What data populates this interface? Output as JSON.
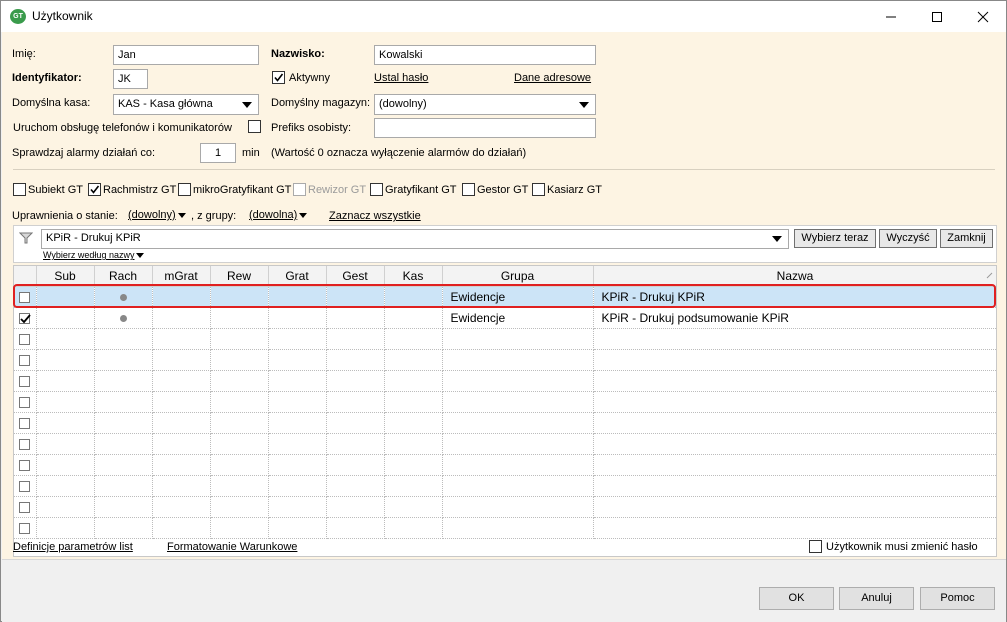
{
  "window": {
    "title": "Użytkownik",
    "icon_text": "GT"
  },
  "form": {
    "first_name_label": "Imię:",
    "first_name_value": "Jan",
    "last_name_label": "Nazwisko:",
    "last_name_value": "Kowalski",
    "identifier_label": "Identyfikator:",
    "identifier_value": "JK",
    "active_label": "Aktywny",
    "set_password_link": "Ustal hasło",
    "address_link": "Dane adresowe",
    "default_cash_label": "Domyślna kasa:",
    "default_cash_value": "KAS - Kasa główna",
    "default_warehouse_label": "Domyślny magazyn:",
    "default_warehouse_value": "(dowolny)",
    "phone_service_label": "Uruchom obsługę telefonów i komunikatorów",
    "personal_prefix_label": "Prefiks osobisty:",
    "personal_prefix_value": "",
    "alarm_label": "Sprawdzaj alarmy działań co:",
    "alarm_value": "1",
    "alarm_unit": "min",
    "alarm_note": "(Wartość 0 oznacza wyłączenie alarmów do działań)"
  },
  "modules": [
    {
      "label": "Subiekt GT",
      "checked": false,
      "disabled": false
    },
    {
      "label": "Rachmistrz GT",
      "checked": true,
      "disabled": false
    },
    {
      "label": "mikroGratyfikant GT",
      "checked": false,
      "disabled": false
    },
    {
      "label": "Rewizor GT",
      "checked": false,
      "disabled": true
    },
    {
      "label": "Gratyfikant GT",
      "checked": false,
      "disabled": false
    },
    {
      "label": "Gestor GT",
      "checked": false,
      "disabled": false
    },
    {
      "label": "Kasiarz GT",
      "checked": false,
      "disabled": false
    }
  ],
  "permissions": {
    "state_label": "Uprawnienia o stanie:",
    "state_value": "(dowolny)",
    "group_label": ", z grupy:",
    "group_value": "(dowolna)",
    "select_all_link": "Zaznacz wszystkie",
    "filter_value": "KPiR - Drukuj KPiR",
    "filter_sub_label": "Wybierz według nazwy",
    "choose_now_button": "Wybierz teraz",
    "clear_button": "Wyczyść",
    "close_button": "Zamknij"
  },
  "grid": {
    "columns": [
      "",
      "Sub",
      "Rach",
      "mGrat",
      "Rew",
      "Grat",
      "Gest",
      "Kas",
      "Grupa",
      "Nazwa"
    ],
    "rows": [
      {
        "checked": false,
        "rach_dot": true,
        "group": "Ewidencje",
        "name": "KPiR - Drukuj KPiR",
        "selected": true
      },
      {
        "checked": true,
        "rach_dot": true,
        "group": "Ewidencje",
        "name": "KPiR - Drukuj podsumowanie KPiR",
        "selected": false
      },
      {
        "checked": false,
        "rach_dot": false,
        "group": "",
        "name": "",
        "selected": false
      },
      {
        "checked": false,
        "rach_dot": false,
        "group": "",
        "name": "",
        "selected": false
      },
      {
        "checked": false,
        "rach_dot": false,
        "group": "",
        "name": "",
        "selected": false
      },
      {
        "checked": false,
        "rach_dot": false,
        "group": "",
        "name": "",
        "selected": false
      },
      {
        "checked": false,
        "rach_dot": false,
        "group": "",
        "name": "",
        "selected": false
      },
      {
        "checked": false,
        "rach_dot": false,
        "group": "",
        "name": "",
        "selected": false
      },
      {
        "checked": false,
        "rach_dot": false,
        "group": "",
        "name": "",
        "selected": false
      },
      {
        "checked": false,
        "rach_dot": false,
        "group": "",
        "name": "",
        "selected": false
      },
      {
        "checked": false,
        "rach_dot": false,
        "group": "",
        "name": "",
        "selected": false
      },
      {
        "checked": false,
        "rach_dot": false,
        "group": "",
        "name": "",
        "selected": false
      }
    ]
  },
  "bottom": {
    "list_params_link": "Definicje parametrów list",
    "conditional_format_link": "Formatowanie Warunkowe",
    "must_change_password_label": "Użytkownik musi zmienić hasło"
  },
  "footer": {
    "ok": "OK",
    "cancel": "Anuluj",
    "help": "Pomoc"
  },
  "colors": {
    "form_bg": "#fdf4e3",
    "selection": "#cce4f7",
    "highlight_outline": "#e02020"
  }
}
